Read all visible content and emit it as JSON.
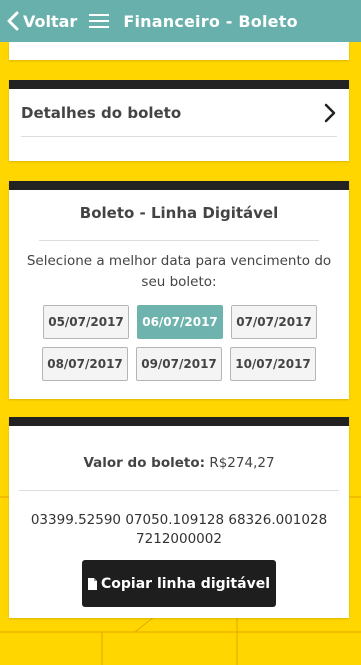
{
  "header": {
    "back_label": "Voltar",
    "title": "Financeiro - Boleto",
    "color": "#68b0ab"
  },
  "details": {
    "label": "Detalhes do boleto"
  },
  "linha_card": {
    "title": "Boleto - Linha Digitável",
    "instruction": "Selecione a melhor data para vencimento do seu boleto:",
    "dates": [
      "05/07/2017",
      "06/07/2017",
      "07/07/2017",
      "08/07/2017",
      "09/07/2017",
      "10/07/2017"
    ],
    "selected_date": "06/07/2017",
    "selected_color": "#6fb3ae"
  },
  "valor_card": {
    "valor_label": "Valor do boleto:",
    "valor_value": "R$274,27",
    "linha_digitavel": "03399.52590 07050.109128 68326.001028 7212000002",
    "copy_label": "Copiar linha digitável"
  },
  "background_color": "#ffd600"
}
